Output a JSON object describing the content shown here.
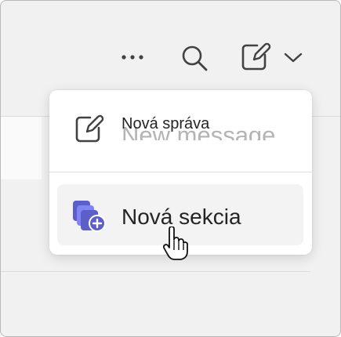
{
  "toolbar": {
    "more_icon": "more-horizontal-icon",
    "search_icon": "search-icon",
    "compose_icon": "compose-icon",
    "chevron_icon": "chevron-down-icon"
  },
  "menu": {
    "items": [
      {
        "label": "Nová správa",
        "overlapped_text": "New message",
        "icon": "compose-icon"
      },
      {
        "label": "Nová sekcia",
        "icon": "new-section-icon",
        "hovered": true
      }
    ]
  },
  "colors": {
    "accent": "#5b5fc7",
    "accent_light": "#9ea2ff",
    "text": "#242424",
    "ghost_text": "#b4b4b4",
    "hover_bg": "#f3f3f3"
  },
  "cursor_icon": "hand-pointer-icon"
}
